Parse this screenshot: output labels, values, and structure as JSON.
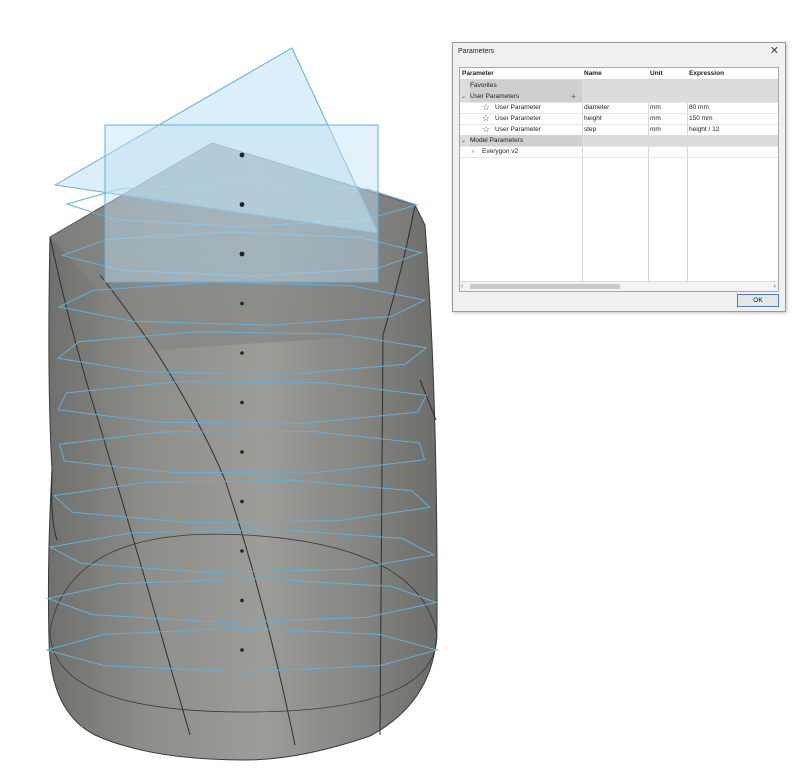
{
  "dialog": {
    "title": "Parameters",
    "close_glyph": "✕",
    "ok_label": "OK",
    "columns": {
      "parameter": "Parameter",
      "name": "Name",
      "unit": "Unit",
      "expression": "Expression"
    },
    "groups": {
      "favorites": "Favorites",
      "user_parameters": "User Parameters",
      "model_parameters": "Model Parameters"
    },
    "user_rows": [
      {
        "type": "User Parameter",
        "name": "diameter",
        "unit": "mm",
        "expression": "80 mm"
      },
      {
        "type": "User Parameter",
        "name": "height",
        "unit": "mm",
        "expression": "150 mm"
      },
      {
        "type": "User Parameter",
        "name": "step",
        "unit": "mm",
        "expression": "height / 12"
      }
    ],
    "model_child": "Everygon v2",
    "icons": {
      "star": "star-icon",
      "add": "plus-icon",
      "expand": "chevron-down-icon",
      "collapsed": "chevron-right-icon"
    }
  },
  "colors": {
    "body": "#8a8a86",
    "edge_highlight": "#5fb0e0",
    "plane_fill": "#bfe0f3",
    "background": "#ffffff"
  }
}
